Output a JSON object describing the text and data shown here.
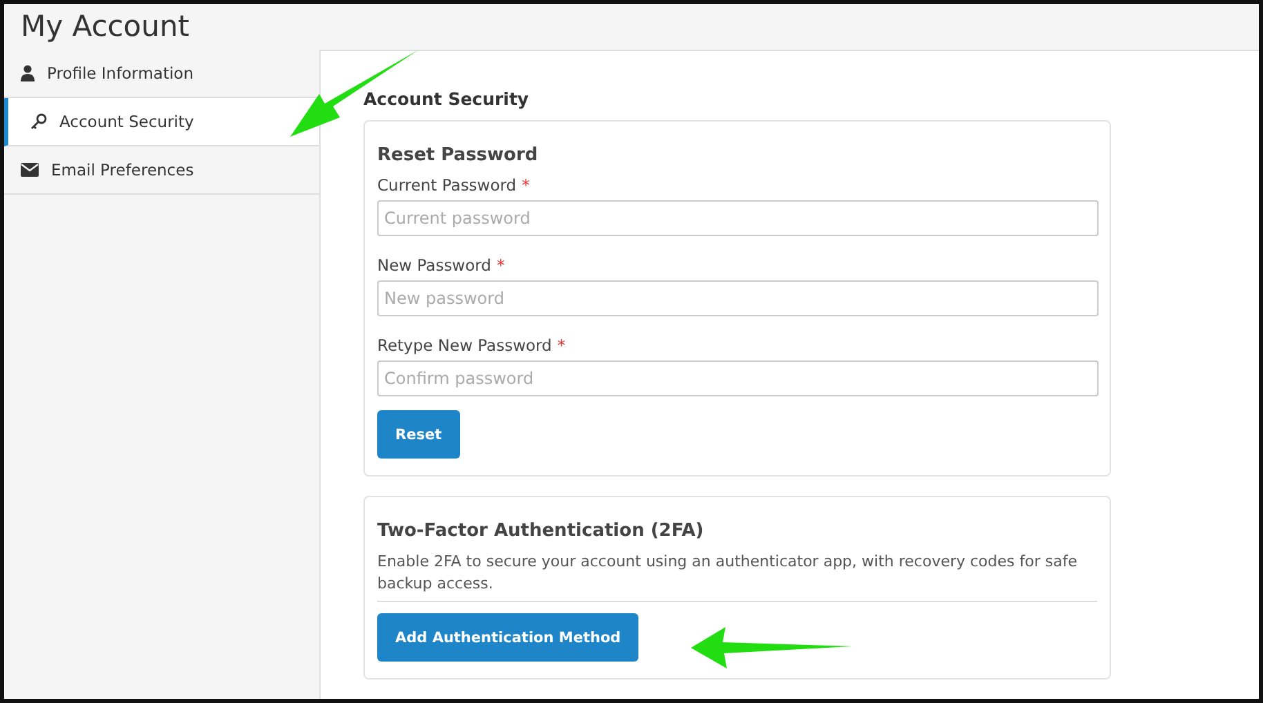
{
  "page": {
    "title": "My Account"
  },
  "sidebar": {
    "items": [
      {
        "label": "Profile Information",
        "kind": "user",
        "selected": false
      },
      {
        "label": "Account Security",
        "kind": "key",
        "selected": true
      },
      {
        "label": "Email Preferences",
        "kind": "envelope",
        "selected": false
      }
    ]
  },
  "section_title": "Account Security",
  "reset_password": {
    "title": "Reset Password",
    "fields": [
      {
        "label": "Current Password",
        "required": true,
        "required_mark": "*",
        "placeholder": "Current password"
      },
      {
        "label": "New Password",
        "required": true,
        "required_mark": "*",
        "placeholder": "New password"
      },
      {
        "label": "Retype New Password",
        "required": true,
        "required_mark": "*",
        "placeholder": "Confirm password"
      }
    ],
    "button": "Reset"
  },
  "two_factor": {
    "title": "Two-Factor Authentication (2FA)",
    "description": "Enable 2FA to secure your account using an authenticator app, with recovery codes for safe backup access.",
    "button": "Add Authentication Method"
  }
}
